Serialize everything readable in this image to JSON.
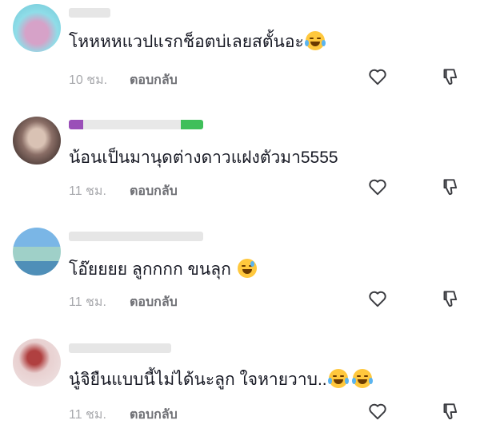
{
  "comments": [
    {
      "username": "",
      "text": "โหหหหแวปแรกช็อตบ่เลยสตั้นอะ",
      "emoji": [
        "laugh-cry-emoji"
      ],
      "time": "10 ชม.",
      "reply_label": "ตอบกลับ",
      "avatar_colors": [
        "#8fdde8",
        "#d6a2c8",
        "#6fc6d6"
      ]
    },
    {
      "username": "",
      "text": "น้อนเป็นมานุดต่างดาวแฝงตัวมา5555",
      "emoji": [],
      "time": "11 ชม.",
      "reply_label": "ตอบกลับ",
      "avatar_colors": [
        "#4a3a36",
        "#d9c2b4",
        "#8a6e66"
      ]
    },
    {
      "username": "",
      "text": "โอ๊ยยยย ลูกกกก ขนลุก",
      "emoji": [
        "grin-sweat-emoji"
      ],
      "time": "11 ชม.",
      "reply_label": "ตอบกลับ",
      "avatar_colors": [
        "#7ab6e6",
        "#9fd0c8",
        "#4f8fb8"
      ]
    },
    {
      "username": "",
      "text": "นู๋จิยืนแบบนี้ไม่ได้นะลูก ใจหายวาบ..",
      "emoji": [
        "laugh-cry-emoji",
        "laugh-cry-emoji"
      ],
      "time": "11 ชม.",
      "reply_label": "ตอบกลับ",
      "avatar_colors": [
        "#e8d0d0",
        "#b04040",
        "#f0e6e6"
      ]
    }
  ]
}
